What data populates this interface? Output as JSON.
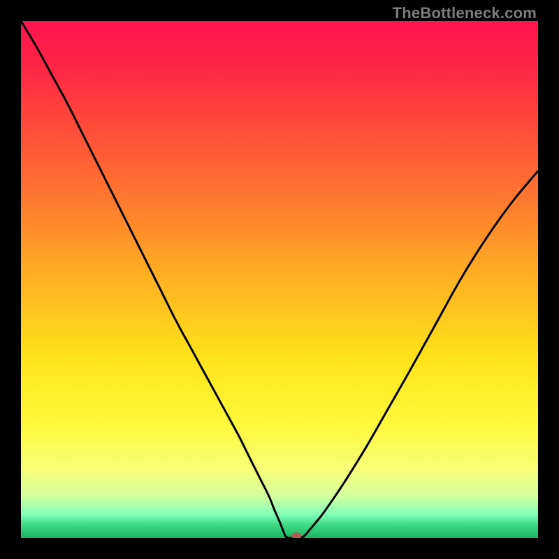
{
  "watermark": "TheBottleneck.com",
  "chart_data": {
    "type": "line",
    "title": "",
    "xlabel": "",
    "ylabel": "",
    "xlim": [
      0,
      100
    ],
    "ylim": [
      0,
      100
    ],
    "grid": false,
    "legend": false,
    "background": {
      "stops": [
        {
          "offset": 0.0,
          "color": "#ff1450"
        },
        {
          "offset": 0.08,
          "color": "#ff2346"
        },
        {
          "offset": 0.2,
          "color": "#ff4a3a"
        },
        {
          "offset": 0.35,
          "color": "#ff7a2e"
        },
        {
          "offset": 0.5,
          "color": "#ffb222"
        },
        {
          "offset": 0.65,
          "color": "#ffe31a"
        },
        {
          "offset": 0.78,
          "color": "#fff83b"
        },
        {
          "offset": 0.87,
          "color": "#f6ff7a"
        },
        {
          "offset": 0.92,
          "color": "#d2ffa0"
        },
        {
          "offset": 0.955,
          "color": "#7dffb8"
        },
        {
          "offset": 0.975,
          "color": "#3dd985"
        },
        {
          "offset": 1.0,
          "color": "#18b45e"
        }
      ]
    },
    "series": [
      {
        "name": "bottleneck-curve",
        "color": "#000000",
        "width": 3,
        "x": [
          0.0,
          3.0,
          6.0,
          9.0,
          12.0,
          15.0,
          18.0,
          21.0,
          24.0,
          27.0,
          30.0,
          33.0,
          36.0,
          39.0,
          42.0,
          43.5,
          45.0,
          46.5,
          48.0,
          49.0,
          50.0,
          50.8,
          51.3,
          52.5,
          54.0,
          55.0,
          56.0,
          58.0,
          60.0,
          63.0,
          67.0,
          71.0,
          75.0,
          80.0,
          85.0,
          90.0,
          95.0,
          100.0
        ],
        "y": [
          100.0,
          95.0,
          89.5,
          84.0,
          78.0,
          72.0,
          66.0,
          60.0,
          54.0,
          48.0,
          42.0,
          36.5,
          31.0,
          25.5,
          20.0,
          17.0,
          14.0,
          11.0,
          8.0,
          5.5,
          3.2,
          1.2,
          0.2,
          0.0,
          0.0,
          0.6,
          1.8,
          4.2,
          7.0,
          11.5,
          18.0,
          25.0,
          32.0,
          41.0,
          50.0,
          58.0,
          65.0,
          71.0
        ]
      }
    ],
    "marker": {
      "name": "optimum-point",
      "x": 53.3,
      "y": 0.0,
      "rx": 7,
      "ry": 5,
      "color": "#b35a52"
    }
  }
}
